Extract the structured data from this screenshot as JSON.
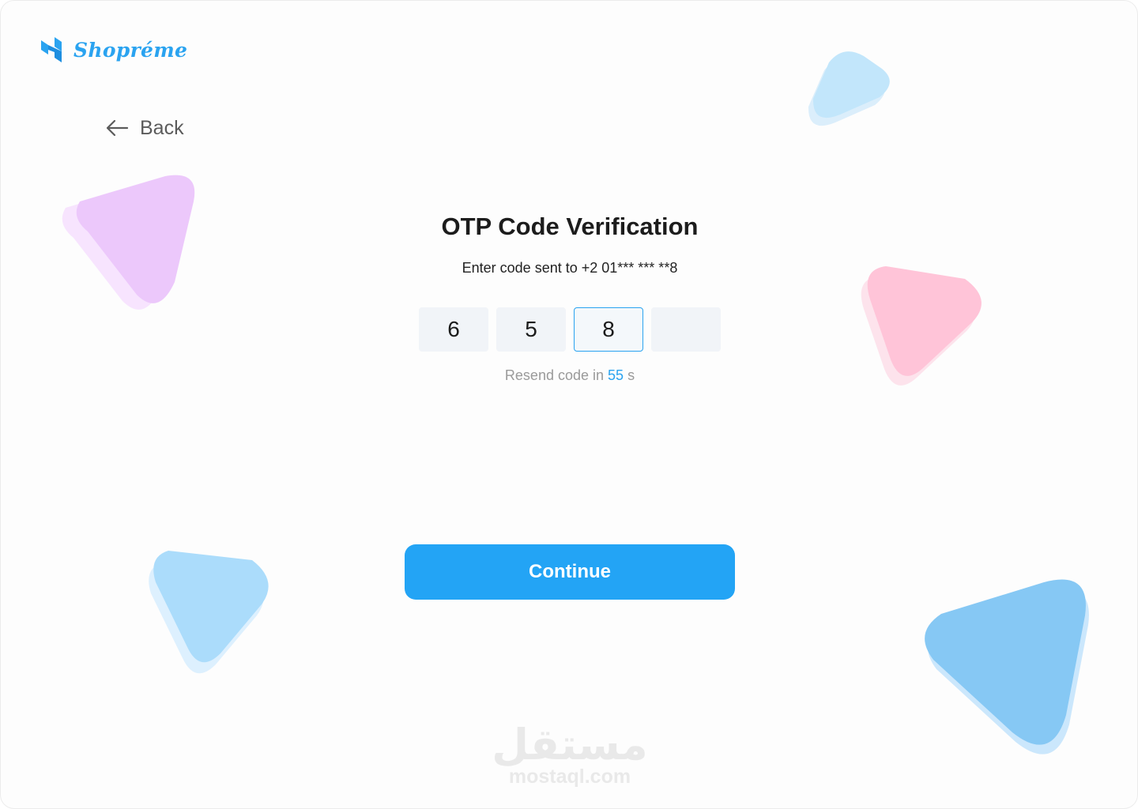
{
  "brand": {
    "name": "Shopréme",
    "logo_icon": "brand-s-mark-icon",
    "color": "#2aa3f0"
  },
  "nav": {
    "back_label": "Back",
    "back_icon": "arrow-left-icon"
  },
  "verification": {
    "title": "OTP Code Verification",
    "subtitle": "Enter code sent to +2 01*** *** **8",
    "digits": [
      "6",
      "5",
      "8",
      ""
    ],
    "resend_prefix": "Resend code in",
    "resend_count": "55",
    "resend_suffix": "s"
  },
  "actions": {
    "continue_label": "Continue"
  },
  "watermark": {
    "arabic": "مستقل",
    "latin": "mostaql.com"
  },
  "colors": {
    "accent": "#23a4f5",
    "blob_purple": "#ecc8fb",
    "blob_pink": "#ffc4d8",
    "blob_light_blue": "#c2e6fb",
    "blob_blue": "#86c8f4"
  }
}
